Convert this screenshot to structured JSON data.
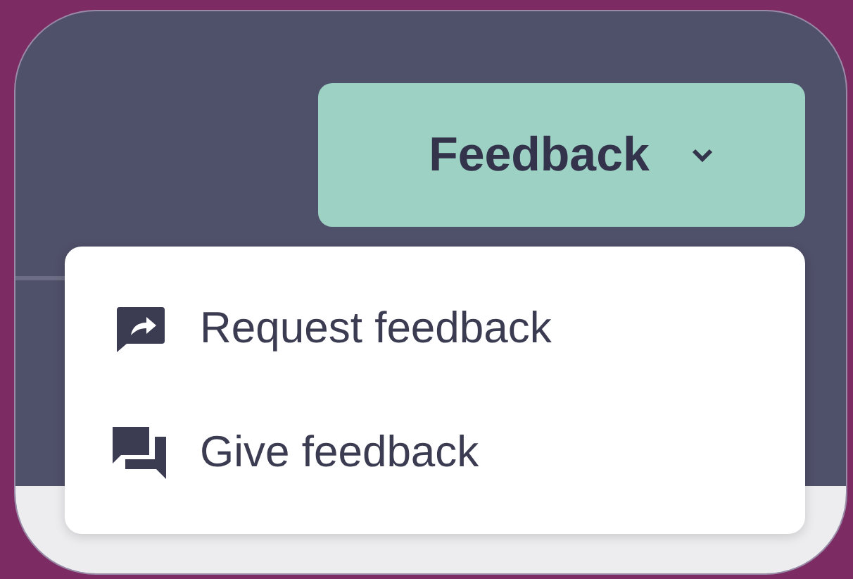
{
  "button": {
    "label": "Feedback",
    "expanded": true
  },
  "menu": {
    "items": [
      {
        "label": "Request feedback",
        "kind": "request"
      },
      {
        "label": "Give feedback",
        "kind": "give"
      }
    ]
  }
}
